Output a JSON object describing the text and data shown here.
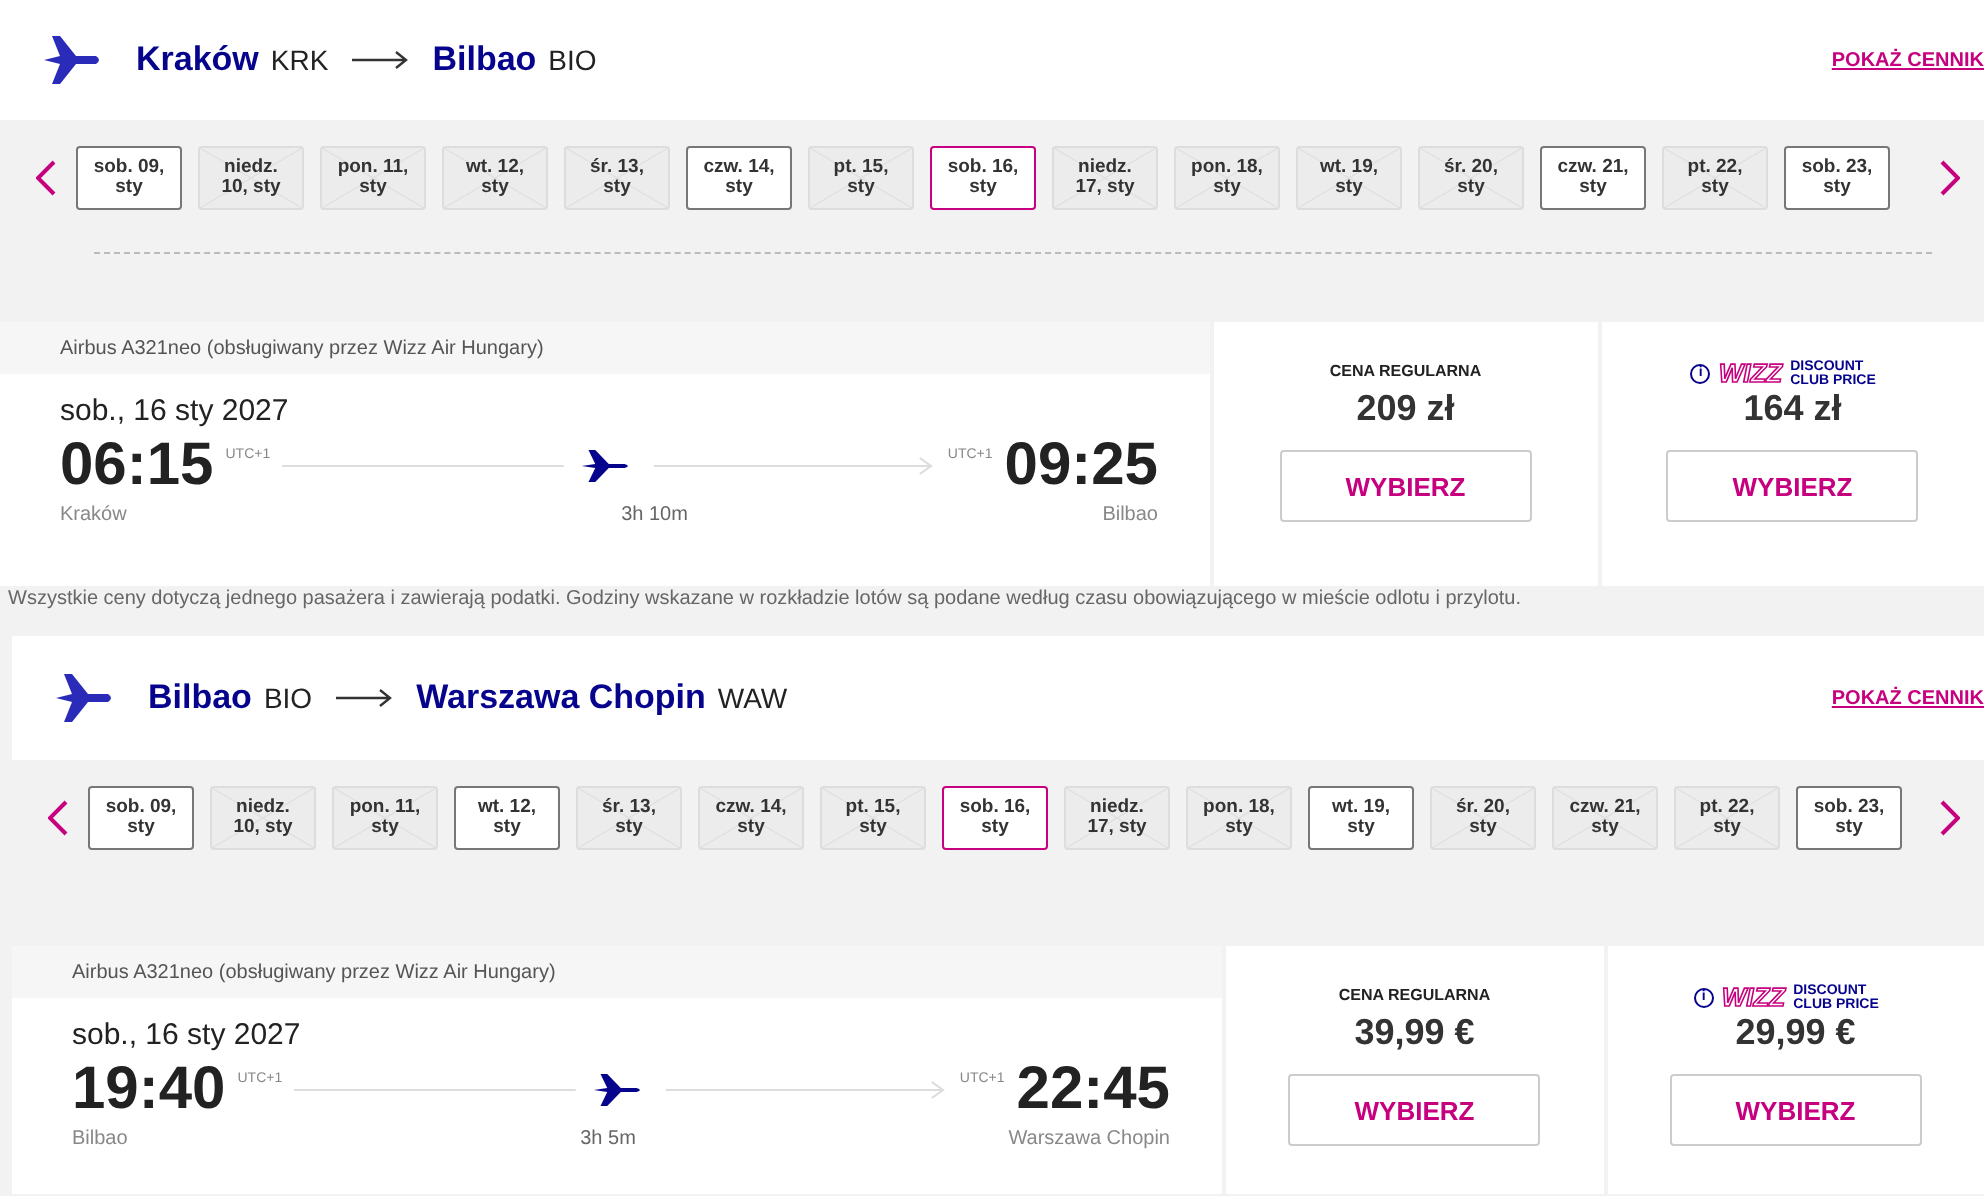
{
  "flights": [
    {
      "from": {
        "city": "Kraków",
        "code": "KRK"
      },
      "to": {
        "city": "Bilbao",
        "code": "BIO"
      },
      "price_link": "POKAŻ CENNIK",
      "dates": [
        {
          "label": "sob. 09, sty",
          "available": true,
          "selected": false
        },
        {
          "label": "niedz. 10, sty",
          "available": false,
          "selected": false
        },
        {
          "label": "pon. 11, sty",
          "available": false,
          "selected": false
        },
        {
          "label": "wt. 12, sty",
          "available": false,
          "selected": false
        },
        {
          "label": "śr. 13, sty",
          "available": false,
          "selected": false
        },
        {
          "label": "czw. 14, sty",
          "available": true,
          "selected": false
        },
        {
          "label": "pt. 15, sty",
          "available": false,
          "selected": false
        },
        {
          "label": "sob. 16, sty",
          "available": true,
          "selected": true
        },
        {
          "label": "niedz. 17, sty",
          "available": false,
          "selected": false
        },
        {
          "label": "pon. 18, sty",
          "available": false,
          "selected": false
        },
        {
          "label": "wt. 19, sty",
          "available": false,
          "selected": false
        },
        {
          "label": "śr. 20, sty",
          "available": false,
          "selected": false
        },
        {
          "label": "czw. 21, sty",
          "available": true,
          "selected": false
        },
        {
          "label": "pt. 22, sty",
          "available": false,
          "selected": false
        },
        {
          "label": "sob. 23, sty",
          "available": true,
          "selected": false
        }
      ],
      "aircraft": "Airbus A321neo (obsługiwany przez Wizz Air Hungary)",
      "date": "sob., 16 sty 2027",
      "departure": {
        "time": "06:15",
        "utc": "UTC+1",
        "city": "Kraków"
      },
      "arrival": {
        "time": "09:25",
        "utc": "UTC+1",
        "city": "Bilbao"
      },
      "duration": "3h 10m",
      "regular": {
        "label": "CENA REGULARNA",
        "price": "209 zł",
        "button": "WYBIERZ"
      },
      "club": {
        "info": "i",
        "logo": "WIZZ",
        "label": "DISCOUNT CLUB PRICE",
        "price": "164 zł",
        "button": "WYBIERZ"
      },
      "note": "Wszystkie ceny dotyczą jednego pasażera i zawierają podatki. Godziny wskazane w rozkładzie lotów są podane według czasu obowiązującego w mieście odlotu i przylotu."
    },
    {
      "from": {
        "city": "Bilbao",
        "code": "BIO"
      },
      "to": {
        "city": "Warszawa Chopin",
        "code": "WAW"
      },
      "price_link": "POKAŻ CENNIK",
      "dates": [
        {
          "label": "sob. 09, sty",
          "available": true,
          "selected": false
        },
        {
          "label": "niedz. 10, sty",
          "available": false,
          "selected": false
        },
        {
          "label": "pon. 11, sty",
          "available": false,
          "selected": false
        },
        {
          "label": "wt. 12, sty",
          "available": true,
          "selected": false
        },
        {
          "label": "śr. 13, sty",
          "available": false,
          "selected": false
        },
        {
          "label": "czw. 14, sty",
          "available": false,
          "selected": false
        },
        {
          "label": "pt. 15, sty",
          "available": false,
          "selected": false
        },
        {
          "label": "sob. 16, sty",
          "available": true,
          "selected": true
        },
        {
          "label": "niedz. 17, sty",
          "available": false,
          "selected": false
        },
        {
          "label": "pon. 18, sty",
          "available": false,
          "selected": false
        },
        {
          "label": "wt. 19, sty",
          "available": true,
          "selected": false
        },
        {
          "label": "śr. 20, sty",
          "available": false,
          "selected": false
        },
        {
          "label": "czw. 21, sty",
          "available": false,
          "selected": false
        },
        {
          "label": "pt. 22, sty",
          "available": false,
          "selected": false
        },
        {
          "label": "sob. 23, sty",
          "available": true,
          "selected": false
        }
      ],
      "aircraft": "Airbus A321neo (obsługiwany przez Wizz Air Hungary)",
      "date": "sob., 16 sty 2027",
      "departure": {
        "time": "19:40",
        "utc": "UTC+1",
        "city": "Bilbao"
      },
      "arrival": {
        "time": "22:45",
        "utc": "UTC+1",
        "city": "Warszawa Chopin"
      },
      "duration": "3h 5m",
      "regular": {
        "label": "CENA REGULARNA",
        "price": "39,99 €",
        "button": "WYBIERZ"
      },
      "club": {
        "info": "i",
        "logo": "WIZZ",
        "label": "DISCOUNT CLUB PRICE",
        "price": "29,99 €",
        "button": "WYBIERZ"
      }
    }
  ]
}
